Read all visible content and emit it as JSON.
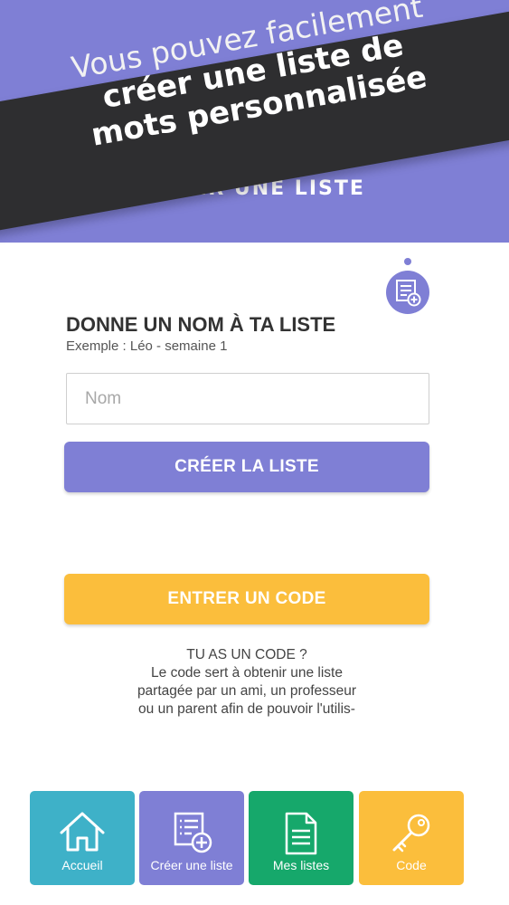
{
  "header": {
    "title": "CRÉER UNE LISTE"
  },
  "banner": {
    "line1": "Vous pouvez facilement",
    "line2": "créer une liste de",
    "line3": "mots personnalisée"
  },
  "form": {
    "title": "DONNE UN NOM À TA LISTE",
    "example": "Exemple : Léo - semaine 1",
    "name_placeholder": "Nom",
    "create_button": "CRÉER LA LISTE"
  },
  "code": {
    "enter_button": "ENTRER UN CODE",
    "question": "TU AS UN CODE ?",
    "description_lines": [
      "Le code sert à obtenir une liste",
      "partagée par un ami, un professeur",
      "ou un parent afin de pouvoir l'utilis-"
    ]
  },
  "nav": {
    "items": [
      {
        "label": "Accueil",
        "icon": "home-icon",
        "color": "#3eb1c8"
      },
      {
        "label": "Créer une liste",
        "icon": "list-add-icon",
        "color": "#7f7fd5"
      },
      {
        "label": "Mes listes",
        "icon": "document-icon",
        "color": "#16a86b"
      },
      {
        "label": "Code",
        "icon": "key-icon",
        "color": "#fbbe3c"
      }
    ]
  },
  "colors": {
    "purple": "#7f7fd5",
    "yellow": "#fbbe3c",
    "teal": "#3eb1c8",
    "green": "#16a86b",
    "banner": "#2e2e30"
  }
}
